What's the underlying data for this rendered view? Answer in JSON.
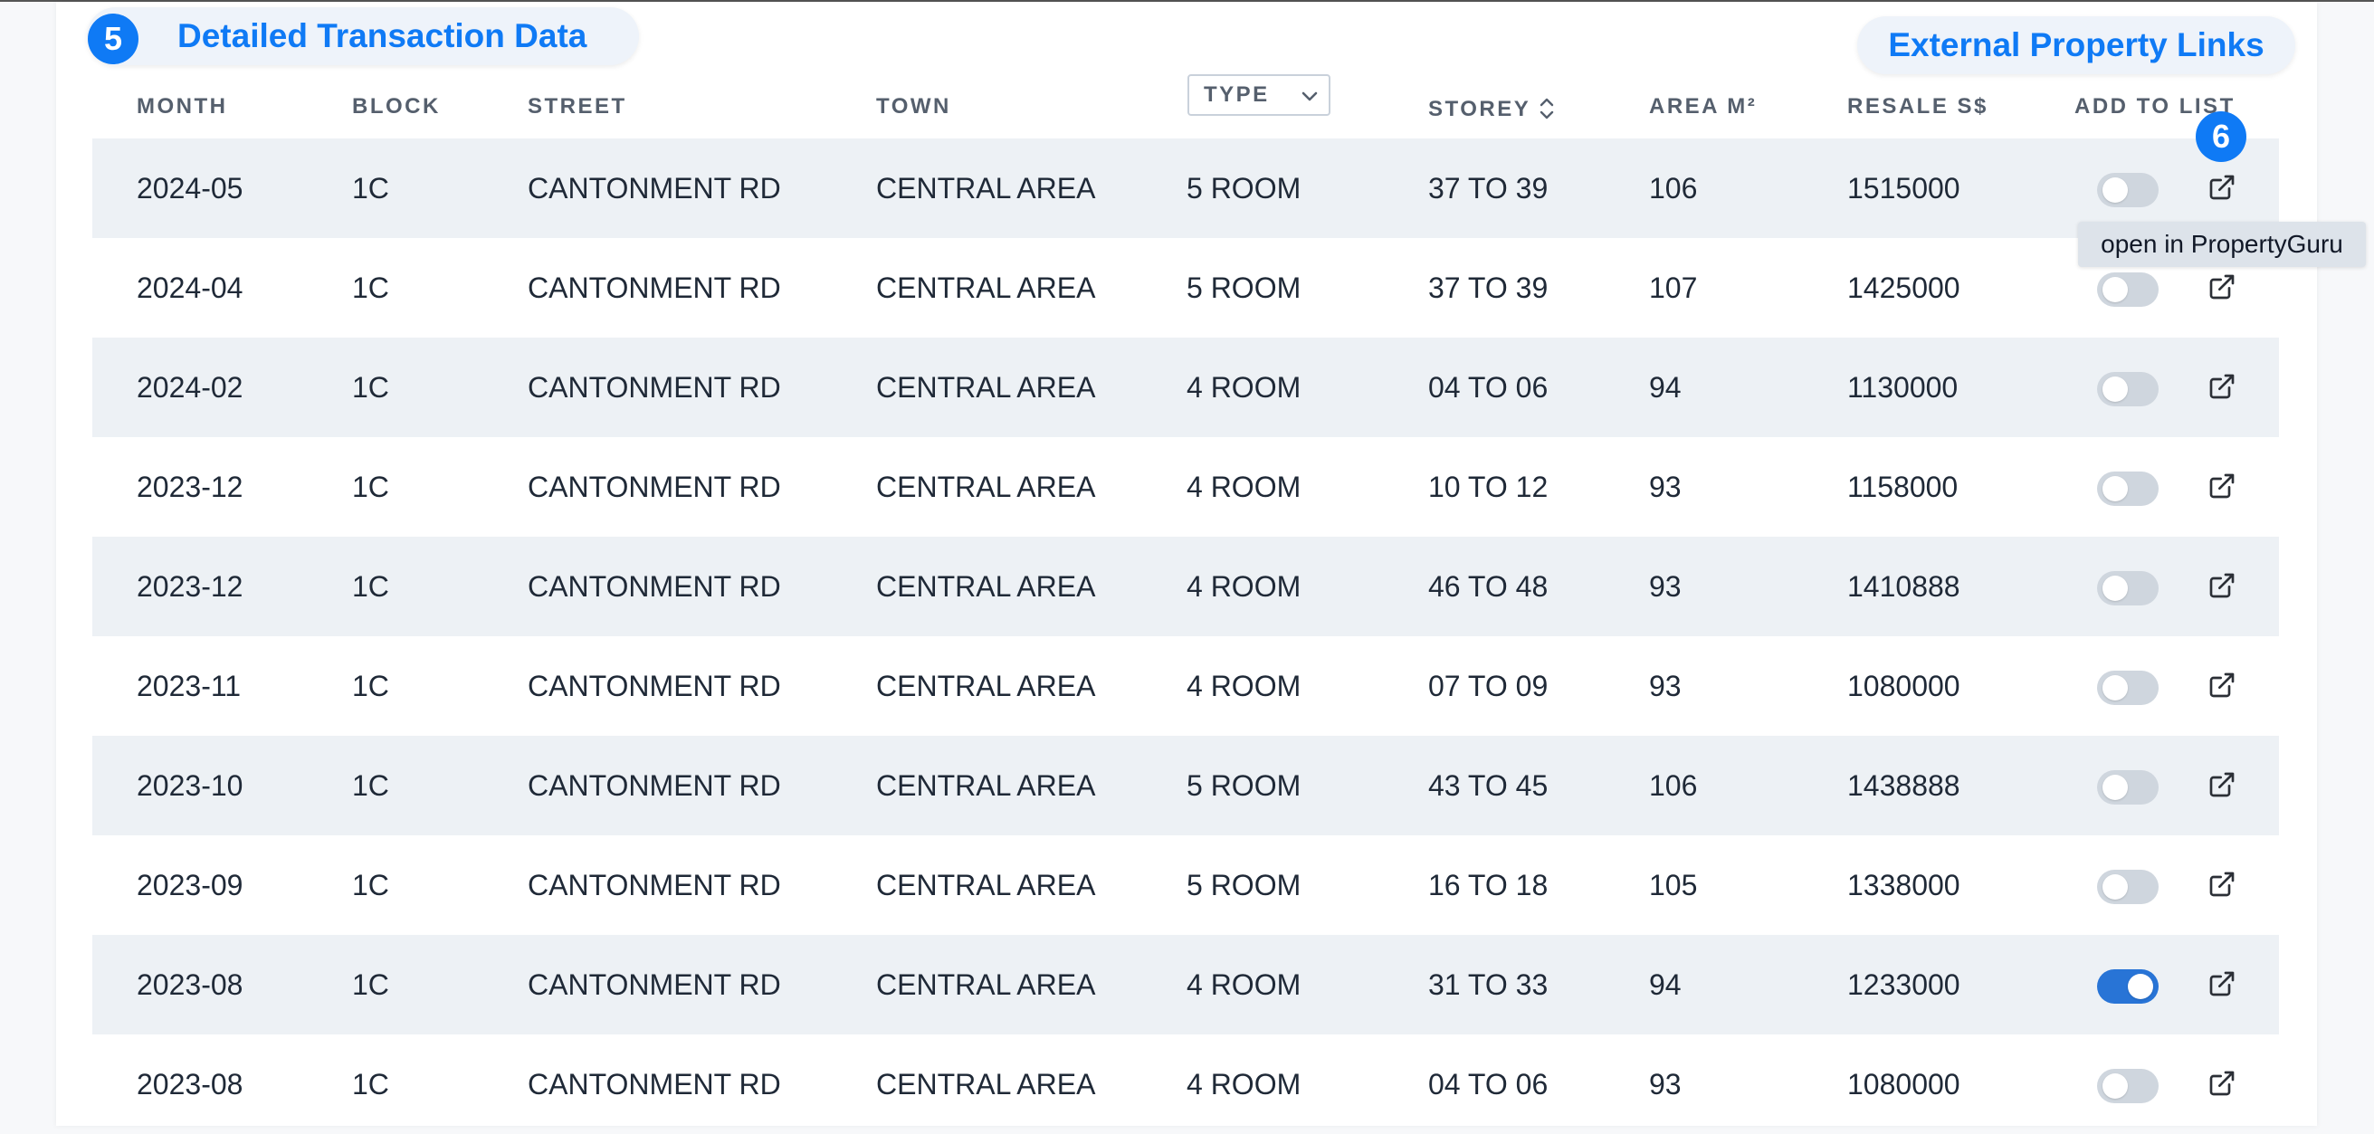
{
  "callouts": {
    "detailed": {
      "number": "5",
      "label": "Detailed Transaction Data"
    },
    "external": {
      "label": "External Property Links"
    },
    "badge6": {
      "number": "6"
    }
  },
  "columns": {
    "month": "MONTH",
    "block": "BLOCK",
    "street": "STREET",
    "town": "TOWN",
    "type": "TYPE",
    "storey": "STOREY",
    "area": "AREA M²",
    "resale": "RESALE S$",
    "add": "ADD TO LIST"
  },
  "tooltip": "open in PropertyGuru",
  "icons": {
    "type_filter": "chevron-down-icon",
    "storey_sort": "sort-icon",
    "row_link": "external-link-icon"
  },
  "colors": {
    "accent": "#0f7af5",
    "toggle_on": "#2874d6",
    "toggle_off": "#cfd6de",
    "row_alt": "#edf1f5"
  },
  "rows": [
    {
      "month": "2024-05",
      "block": "1C",
      "street": "CANTONMENT RD",
      "town": "CENTRAL AREA",
      "type": "5 ROOM",
      "storey": "37 TO 39",
      "area": "106",
      "resale": "1515000",
      "in_list": false
    },
    {
      "month": "2024-04",
      "block": "1C",
      "street": "CANTONMENT RD",
      "town": "CENTRAL AREA",
      "type": "5 ROOM",
      "storey": "37 TO 39",
      "area": "107",
      "resale": "1425000",
      "in_list": false
    },
    {
      "month": "2024-02",
      "block": "1C",
      "street": "CANTONMENT RD",
      "town": "CENTRAL AREA",
      "type": "4 ROOM",
      "storey": "04 TO 06",
      "area": "94",
      "resale": "1130000",
      "in_list": false
    },
    {
      "month": "2023-12",
      "block": "1C",
      "street": "CANTONMENT RD",
      "town": "CENTRAL AREA",
      "type": "4 ROOM",
      "storey": "10 TO 12",
      "area": "93",
      "resale": "1158000",
      "in_list": false
    },
    {
      "month": "2023-12",
      "block": "1C",
      "street": "CANTONMENT RD",
      "town": "CENTRAL AREA",
      "type": "4 ROOM",
      "storey": "46 TO 48",
      "area": "93",
      "resale": "1410888",
      "in_list": false
    },
    {
      "month": "2023-11",
      "block": "1C",
      "street": "CANTONMENT RD",
      "town": "CENTRAL AREA",
      "type": "4 ROOM",
      "storey": "07 TO 09",
      "area": "93",
      "resale": "1080000",
      "in_list": false
    },
    {
      "month": "2023-10",
      "block": "1C",
      "street": "CANTONMENT RD",
      "town": "CENTRAL AREA",
      "type": "5 ROOM",
      "storey": "43 TO 45",
      "area": "106",
      "resale": "1438888",
      "in_list": false
    },
    {
      "month": "2023-09",
      "block": "1C",
      "street": "CANTONMENT RD",
      "town": "CENTRAL AREA",
      "type": "5 ROOM",
      "storey": "16 TO 18",
      "area": "105",
      "resale": "1338000",
      "in_list": false
    },
    {
      "month": "2023-08",
      "block": "1C",
      "street": "CANTONMENT RD",
      "town": "CENTRAL AREA",
      "type": "4 ROOM",
      "storey": "31 TO 33",
      "area": "94",
      "resale": "1233000",
      "in_list": true
    },
    {
      "month": "2023-08",
      "block": "1C",
      "street": "CANTONMENT RD",
      "town": "CENTRAL AREA",
      "type": "4 ROOM",
      "storey": "04 TO 06",
      "area": "93",
      "resale": "1080000",
      "in_list": false
    }
  ]
}
